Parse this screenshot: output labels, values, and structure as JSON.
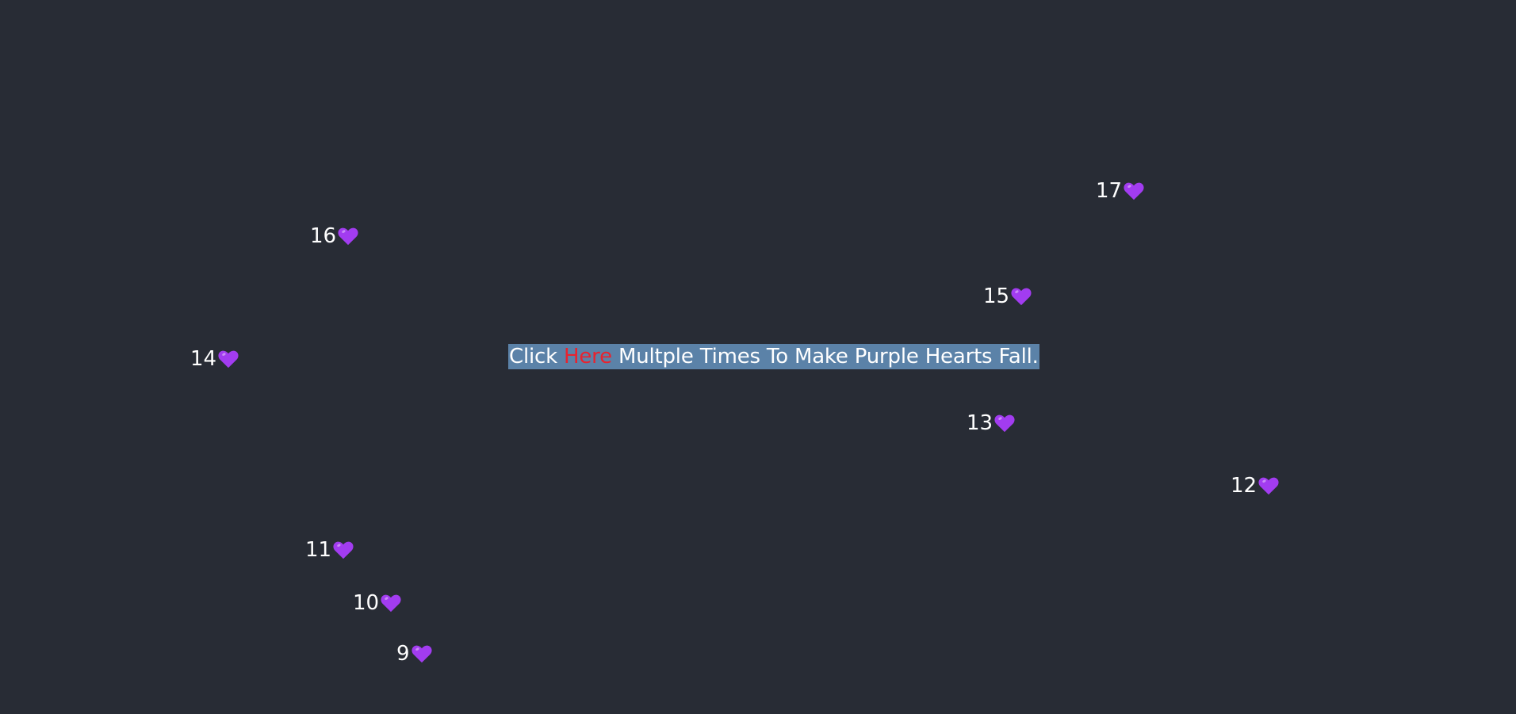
{
  "theme": {
    "background": "#282c35",
    "highlight": "#5b82a8",
    "link_color": "#e8232f",
    "heart_color": "#a23cf0"
  },
  "headline": {
    "prefix": "Click ",
    "link": "Here",
    "suffix": " Multple Times To Make Purple Hearts Fall."
  },
  "hearts": [
    {
      "number": "9",
      "icon": "purple-heart-icon"
    },
    {
      "number": "10",
      "icon": "purple-heart-icon"
    },
    {
      "number": "11",
      "icon": "purple-heart-icon"
    },
    {
      "number": "12",
      "icon": "purple-heart-icon"
    },
    {
      "number": "13",
      "icon": "purple-heart-icon"
    },
    {
      "number": "14",
      "icon": "purple-heart-icon"
    },
    {
      "number": "15",
      "icon": "purple-heart-icon"
    },
    {
      "number": "16",
      "icon": "purple-heart-icon"
    },
    {
      "number": "17",
      "icon": "purple-heart-icon"
    }
  ]
}
